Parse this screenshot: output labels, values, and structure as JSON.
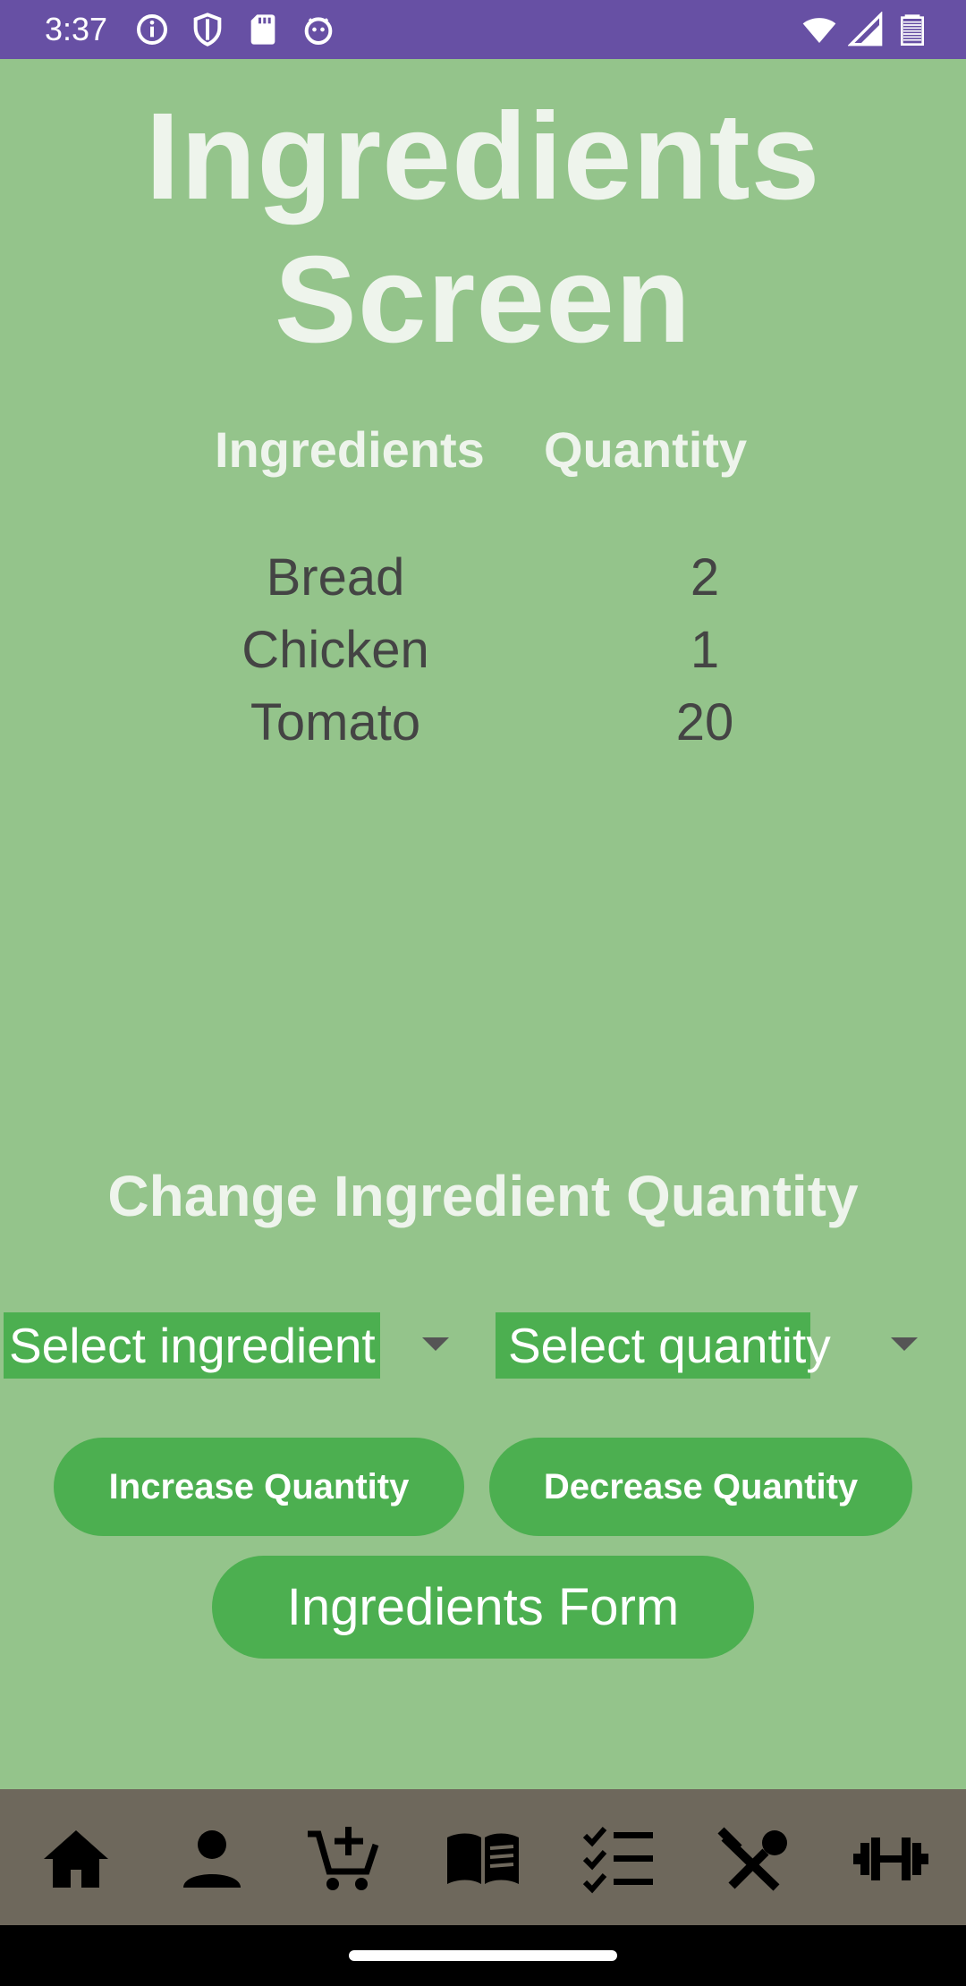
{
  "status_bar": {
    "time": "3:37"
  },
  "title": {
    "line1": "Ingredients",
    "line2": "Screen"
  },
  "table": {
    "headers": {
      "ingredients": "Ingredients",
      "quantity": "Quantity"
    },
    "rows": [
      {
        "ingredient": "Bread",
        "quantity": "2"
      },
      {
        "ingredient": "Chicken",
        "quantity": "1"
      },
      {
        "ingredient": "Tomato",
        "quantity": "20"
      }
    ]
  },
  "change_section": {
    "title": "Change Ingredient Quantity",
    "ingredient_select": "Select ingredient",
    "quantity_select": "Select quantity",
    "increase_label": "Increase Quantity",
    "decrease_label": "Decrease Quantity",
    "form_label": "Ingredients Form"
  },
  "nav": {
    "items": [
      "home-icon",
      "person-icon",
      "add-to-cart-icon",
      "menu-book-icon",
      "checklist-icon",
      "restaurant-icon",
      "fitness-icon"
    ]
  },
  "colors": {
    "background": "#94c48b",
    "status_bar": "#6750a4",
    "accent_green": "#4caf50",
    "nav_bar": "#6e685c",
    "heading_text": "#eef4ec",
    "body_text": "#444444"
  }
}
